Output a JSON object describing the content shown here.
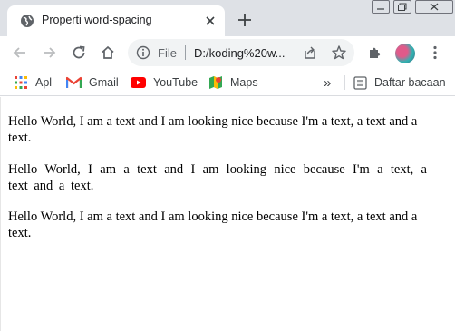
{
  "tab": {
    "title": "Properti word-spacing"
  },
  "address_bar": {
    "scheme": "File",
    "url": "D:/koding%20w..."
  },
  "bookmarks": {
    "items": [
      {
        "label": "Apl",
        "icon": "apps-grid-icon"
      },
      {
        "label": "Gmail",
        "icon": "gmail-icon"
      },
      {
        "label": "YouTube",
        "icon": "youtube-icon"
      },
      {
        "label": "Maps",
        "icon": "maps-icon"
      }
    ],
    "more_label": "»",
    "reading_list": "Daftar bacaan"
  },
  "page": {
    "paragraphs": [
      "Hello World, I am a text and I am looking nice because I'm a text, a text and a text.",
      "Hello World, I am a text and I am looking nice because I'm a text, a text and a text.",
      "Hello World, I am a text and I am looking nice because I'm a text, a text and a text."
    ]
  },
  "colors": {
    "tabstrip": "#dee1e6",
    "omnibox": "#f1f3f4",
    "text": "#000000",
    "chrome_text": "#3c4043"
  }
}
